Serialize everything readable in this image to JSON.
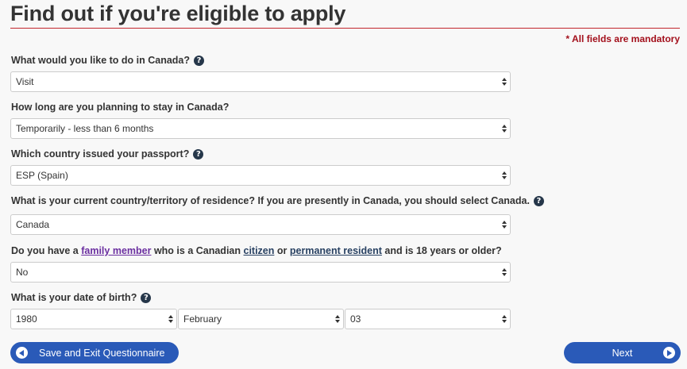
{
  "page": {
    "title": "Find out if you're eligible to apply",
    "mandatory_note": "* All fields are mandatory"
  },
  "questions": {
    "purpose": {
      "label": "What would you like to do in Canada?",
      "value": "Visit"
    },
    "duration": {
      "label": "How long are you planning to stay in Canada?",
      "value": "Temporarily - less than 6 months"
    },
    "passport": {
      "label": "Which country issued your passport?",
      "value": "ESP (Spain)"
    },
    "residence": {
      "label": "What is your current country/territory of residence? If you are presently in Canada, you should select Canada.",
      "value": "Canada"
    },
    "family": {
      "label_part1": "Do you have a",
      "link_family": "family member",
      "label_part2": "who is a Canadian",
      "link_citizen": "citizen",
      "label_part3": "or",
      "link_pr": "permanent resident",
      "label_part4": "and is 18 years or older?",
      "value": "No"
    },
    "dob": {
      "label": "What is your date of birth?",
      "year": "1980",
      "month": "February",
      "day": "03"
    }
  },
  "buttons": {
    "save_exit": "Save and Exit Questionnaire",
    "next": "Next"
  },
  "colors": {
    "accent": "#2a5ab8",
    "rule": "#c2262d",
    "mandatory": "#a3101c",
    "help": "#26374a"
  }
}
